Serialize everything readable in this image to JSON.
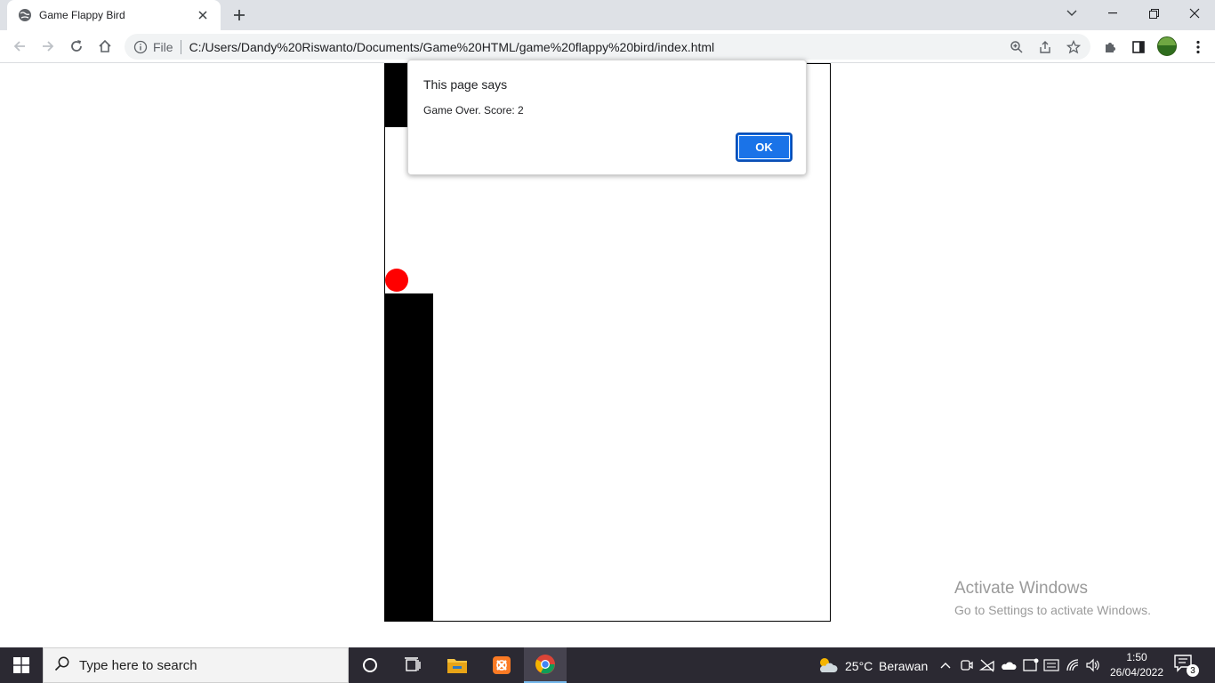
{
  "browser": {
    "tab": {
      "title": "Game Flappy Bird"
    },
    "address_bar": {
      "security_label": "File",
      "url": "C:/Users/Dandy%20Riswanto/Documents/Game%20HTML/game%20flappy%20bird/index.html"
    }
  },
  "game": {
    "canvas_background": "#ffffff",
    "pipe_color": "#000000",
    "bird_color": "#ff0000"
  },
  "dialog": {
    "title": "This page says",
    "message": "Game Over. Score: 2",
    "ok_label": "OK"
  },
  "watermark": {
    "title": "Activate Windows",
    "subtitle": "Go to Settings to activate Windows."
  },
  "taskbar": {
    "search_placeholder": "Type here to search",
    "weather": {
      "temperature": "25°C",
      "condition": "Berawan"
    },
    "clock": {
      "time": "1:50",
      "date": "26/04/2022"
    },
    "notification_count": "3",
    "pinned_apps": [
      "cortana-icon",
      "task-view-icon",
      "file-explorer-icon",
      "xampp-icon",
      "chrome-icon"
    ]
  }
}
